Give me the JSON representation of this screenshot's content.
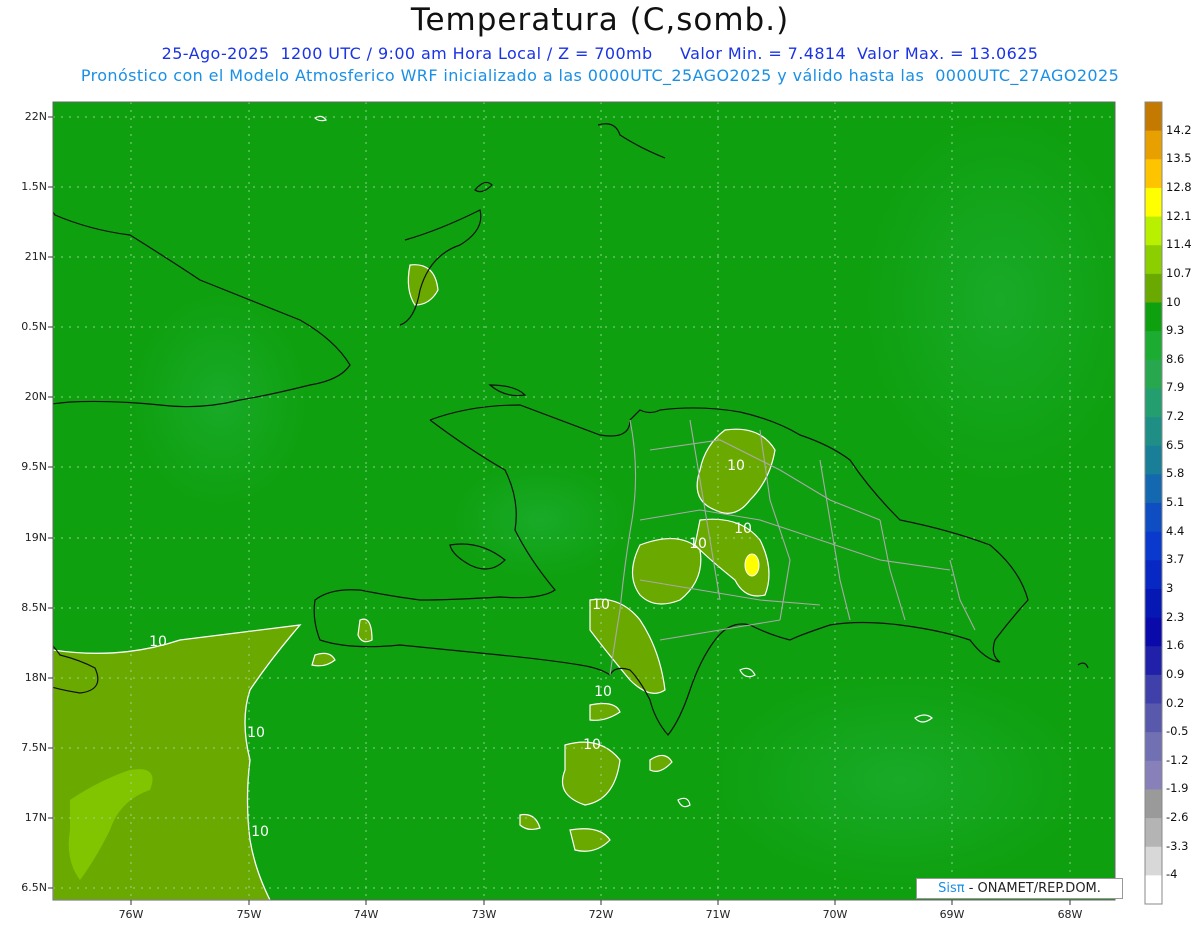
{
  "header": {
    "title": "Temperatura (C,somb.)",
    "line1": "25-Ago-2025  1200 UTC / 9:00 am Hora Local / Z = 700mb     Valor Min. = 7.4814  Valor Max. = 13.0625",
    "line2": "Pronóstico con el Modelo Atmosferico WRF inicializado a las 0000UTC_25AGO2025 y válido hasta las  0000UTC_27AGO2025"
  },
  "axes": {
    "lat_labels": [
      "22N",
      "1.5N",
      "21N",
      "0.5N",
      "20N",
      "9.5N",
      "19N",
      "8.5N",
      "18N",
      "7.5N",
      "17N",
      "6.5N"
    ],
    "lon_labels": [
      "76W",
      "75W",
      "74W",
      "73W",
      "72W",
      "71W",
      "70W",
      "69W",
      "68W"
    ]
  },
  "colorbar": {
    "labels": [
      "14.2",
      "13.5",
      "12.8",
      "12.1",
      "11.4",
      "10.7",
      "10",
      "9.3",
      "8.6",
      "7.9",
      "7.2",
      "6.5",
      "5.8",
      "5.1",
      "4.4",
      "3.7",
      "3",
      "2.3",
      "1.6",
      "0.9",
      "0.2",
      "-0.5",
      "-1.2",
      "-1.9",
      "-2.6",
      "-3.3",
      "-4"
    ],
    "colors": [
      "#c47a00",
      "#e8a000",
      "#ffc400",
      "#ffff00",
      "#b8f000",
      "#8ccf00",
      "#6aaa00",
      "#0ea00e",
      "#1cac32",
      "#28a84e",
      "#239e6e",
      "#1f8f86",
      "#197f99",
      "#1468b0",
      "#0f4ec2",
      "#0a3acd",
      "#0828c4",
      "#0618b4",
      "#0a0aaa",
      "#2020a8",
      "#4040aa",
      "#5858ad",
      "#7070b2",
      "#8880b8",
      "#9a9a9a",
      "#b4b4b4",
      "#d8d8d8",
      "#ffffff"
    ]
  },
  "contour_labels": [
    "10",
    "10",
    "10",
    "10",
    "10",
    "10",
    "10",
    "10",
    "10"
  ],
  "credit": {
    "sis": "Sisπ",
    "rest": "- ONAMET/REP.DOM."
  }
}
